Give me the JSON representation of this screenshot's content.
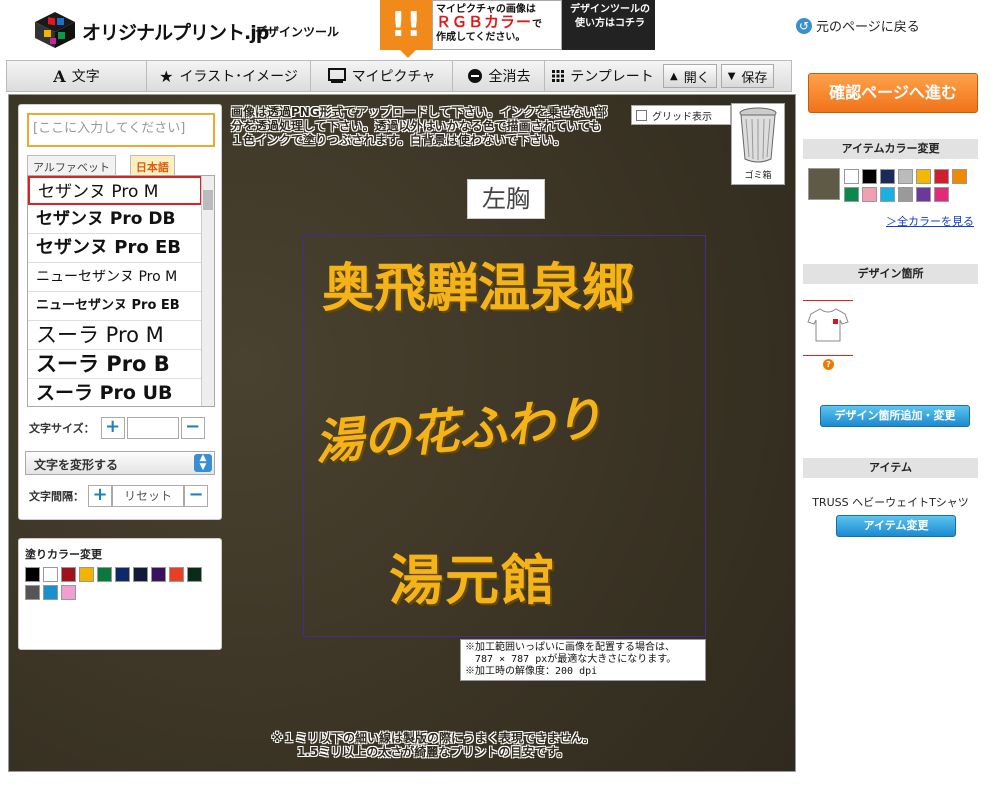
{
  "header": {
    "logo_text": "オリジナルプリント.jp",
    "logo_sub": "デザインツール",
    "banner_line1": "マイピクチャの画像は",
    "banner_rgb": "ＲＧＢカラー",
    "banner_line2_suffix": "で",
    "banner_line3": "作成してください。",
    "banner_help": "デザインツールの使い方はコチラ",
    "back_label": "元のページに戻る"
  },
  "toolbar": {
    "items": [
      {
        "label": "文字",
        "icon": "A"
      },
      {
        "label": "イラスト･イメージ",
        "icon": "★"
      },
      {
        "label": "マイピクチャ",
        "icon": "monitor-icon"
      },
      {
        "label": "全消去",
        "icon": "minus-circle-icon"
      },
      {
        "label": "テンプレート",
        "icon": "grid-icon"
      }
    ],
    "open_label": "開く",
    "save_label": "保存"
  },
  "text_panel": {
    "input_placeholder": "[ここに入力してください]",
    "tabs": [
      "アルファベット",
      "日本語"
    ],
    "active_tab": "日本語",
    "fonts": [
      "セザンヌ Pro M",
      "セザンヌ Pro DB",
      "セザンヌ Pro EB",
      "ニューセザンヌ Pro M",
      "ニューセザンヌ Pro EB",
      "スーラ Pro M",
      "スーラ Pro B",
      "スーラ Pro UB"
    ],
    "selected_font": "セザンヌ Pro M",
    "size_label": "文字サイズ：",
    "transform_label": "文字を変形する",
    "spacing_label": "文字間隔：",
    "reset_label": "リセット"
  },
  "fill_panel": {
    "title": "塗りカラー変更",
    "colors": [
      "#000000",
      "#ffffff",
      "#a0131b",
      "#f5b300",
      "#0a7a3a",
      "#0c2a6a",
      "#111a3a",
      "#3a1060",
      "#e84020",
      "#0a2a1a",
      "#555555",
      "#1a90d0",
      "#f0a0d0"
    ]
  },
  "canvas": {
    "notice_top": "画像は透過PNG形式でアップロードして下さい。インクを乗せない部分を透過処理して下さい。透過以外はいかなる色で描画されていても１色インクで塗りつぶされます。白背景は使わないで下さい。",
    "grid_label": "グリッド表示",
    "trash_label": "ゴミ箱",
    "placement_label": "左胸",
    "design_lines": [
      "奥飛騨温泉郷",
      "湯の花ふわり",
      "湯元館"
    ],
    "size_note": [
      "※加工範囲いっぱいに画像を配置する場合は、",
      "　787 × 787 pxが最適な大きさになります。",
      "※加工時の解像度：200 dpi"
    ],
    "notice_bottom_1": "※１ミリ以下の細い線は製版の際にうまく表現できません。",
    "notice_bottom_2": "1.5ミリ以上の太さが綺麗なプリントの目安です。",
    "design_color": "#f4b419"
  },
  "sidebar": {
    "confirm_label": "確認ページへ進む",
    "item_color_title": "アイテムカラー変更",
    "current_item_color": "#5f5a45",
    "item_colors": [
      "#ffffff",
      "#000000",
      "#1a2a5a",
      "#bbbbbb",
      "#f5b800",
      "#d02030",
      "#f08a00",
      "#0a8a4a",
      "#f0a0b0",
      "#1ab0e0",
      "#9a9a9a",
      "#6a3a9a",
      "#e02a7a"
    ],
    "all_colors_label": "＞全カラーを見る",
    "design_place_title": "デザイン箇所",
    "add_place_label": "デザイン箇所追加・変更",
    "item_title": "アイテム",
    "item_name": "TRUSS ヘビーウェイトTシャツ",
    "item_change_label": "アイテム変更"
  }
}
